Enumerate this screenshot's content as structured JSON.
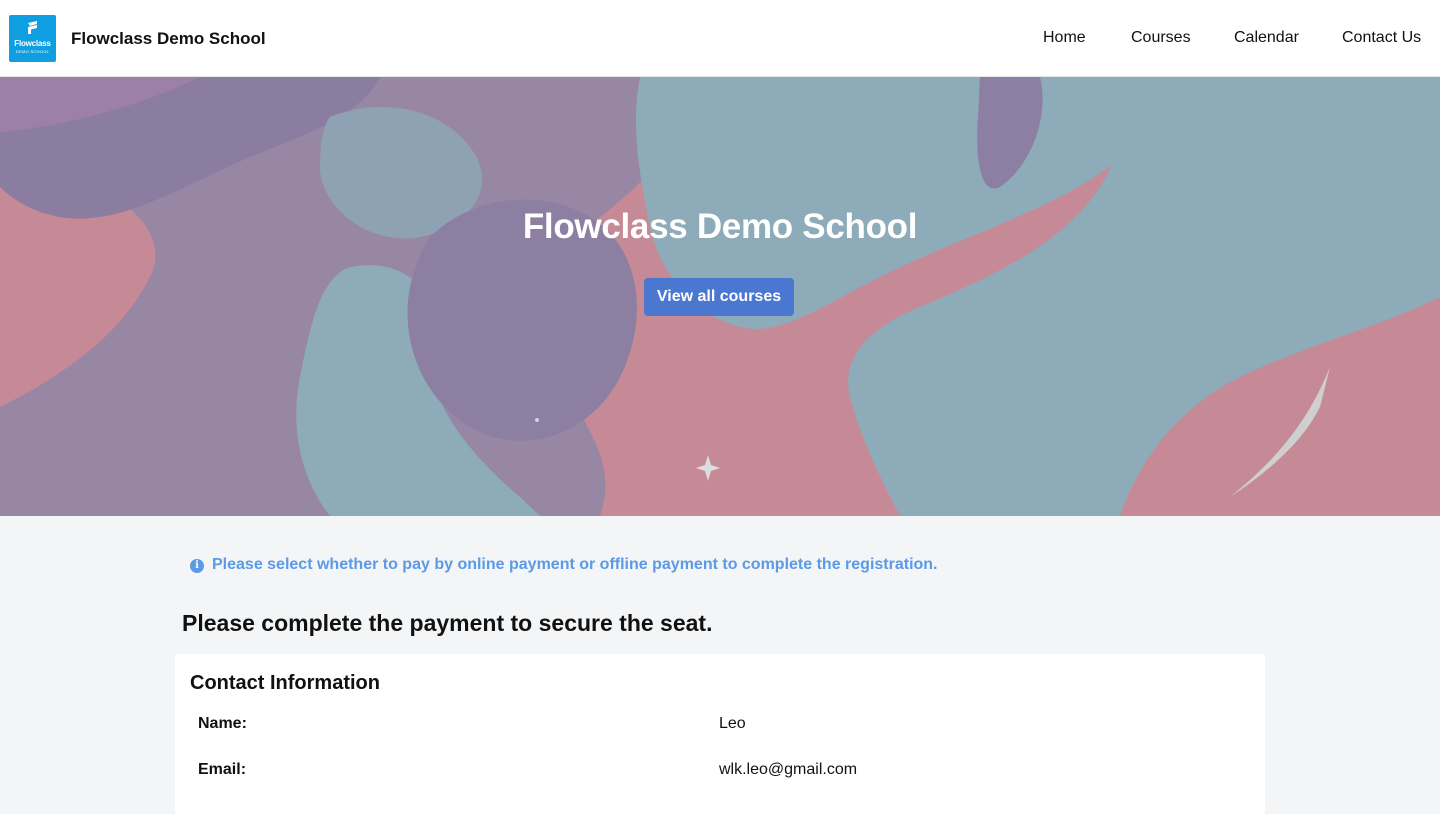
{
  "header": {
    "logo_text": "Flowclass",
    "logo_subtext": "DEMO SCHOOL",
    "site_name": "Flowclass Demo School",
    "nav": [
      "Home",
      "Courses",
      "Calendar",
      "Contact Us"
    ]
  },
  "hero": {
    "title": "Flowclass Demo School",
    "button_label": "View all courses"
  },
  "notice": {
    "icon": "info-icon",
    "text": "Please select whether to pay by online payment or offline payment to complete the registration."
  },
  "payment": {
    "heading": "Please complete the payment to secure the seat."
  },
  "contact": {
    "title": "Contact Information",
    "rows": [
      {
        "label": "Name:",
        "value": "Leo"
      },
      {
        "label": "Email:",
        "value": "wlk.leo@gmail.com"
      }
    ]
  },
  "colors": {
    "brand_blue": "#0f9fe0",
    "button_blue": "#4a78d0",
    "notice_blue": "#5a9ae6"
  }
}
